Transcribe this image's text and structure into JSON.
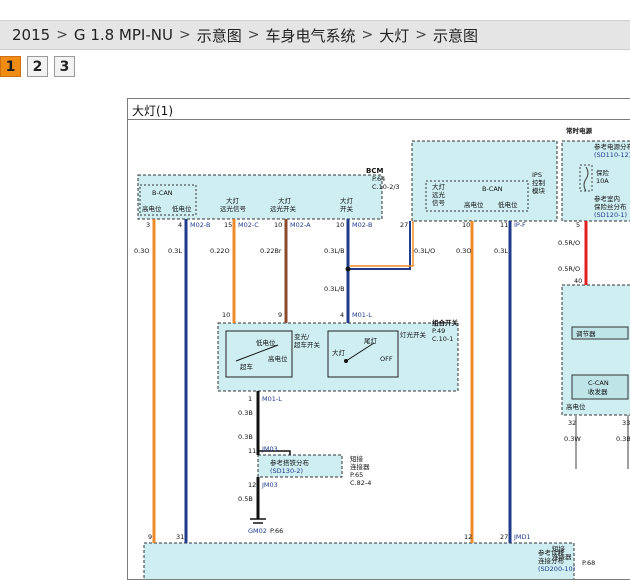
{
  "breadcrumb": [
    "2015",
    "G 1.8 MPI-NU",
    "示意图",
    "车身电气系统",
    "大灯",
    "示意图"
  ],
  "breadcrumb_separator": ">",
  "pagination": {
    "pages": [
      "1",
      "2",
      "3"
    ],
    "active_index": 0
  },
  "diagram": {
    "title": "大灯(1)",
    "colors": {
      "module_fill": "#cfeef2",
      "orange_wire": "#ef8a2a",
      "blue_wire": "#1f3b8c",
      "brown_wire": "#8b4a2b",
      "red_wire": "#e02020",
      "gray_wire": "#a0a0a0"
    },
    "bcm": {
      "name": "BCM",
      "ref_page": "P.64",
      "ref_code": "C.10-2/3",
      "bcan_label": "B-CAN",
      "high": "高电位",
      "low": "低电位",
      "pin_labels": [
        {
          "l1": "大灯",
          "l2": "远光信号"
        },
        {
          "l1": "大灯",
          "l2": "远光开关"
        },
        {
          "l1": "大灯",
          "l2": "开关"
        }
      ],
      "pins": [
        "3",
        "4",
        "15",
        "10",
        "10"
      ],
      "connectors": [
        "M02-B",
        "M02-C",
        "M02-A",
        "M02-B"
      ],
      "wires": [
        "0.3O",
        "0.3L",
        "0.22O",
        "0.22Br",
        "0.3L/B",
        "0.3L/O"
      ]
    },
    "ips": {
      "name_lines": [
        "IPS",
        "控制",
        "模块"
      ],
      "bcan_label": "B-CAN",
      "high": "高电位",
      "low": "低电位",
      "beam_lines": [
        "大灯",
        "远光",
        "信号"
      ],
      "pins": [
        "27",
        "10",
        "11"
      ],
      "connector": "IP-F",
      "wires": [
        "0.3O",
        "0.3L"
      ]
    },
    "always_power": {
      "label": "常时电源",
      "ref1": "参考电源分布",
      "ref1_code": "(SD110-12)",
      "fuse_lines": [
        "保险",
        "10A"
      ],
      "ref2_lines": [
        "参考室内",
        "保险丝分布"
      ],
      "ref2_code": "(SD120-1)",
      "pins": [
        "5",
        "40",
        "32",
        "33"
      ],
      "wires": [
        "0.5R/O",
        "0.5R/O",
        "0.3W",
        "0.3B"
      ],
      "regulator": "调节器",
      "ccan_lines": [
        "C-CAN",
        "收发器"
      ],
      "high": "高电位"
    },
    "combo_switch": {
      "name": "组合开关",
      "ref_page": "P.49",
      "ref_code": "C.10-1",
      "pins": [
        "10",
        "9",
        "4",
        "1"
      ],
      "connector_top": "M01-L",
      "connector_bottom": "M01-L",
      "left_lines": [
        "变光/",
        "超车开关"
      ],
      "low_beam": "低电位",
      "passing": "超车",
      "high_beam": "高电位",
      "light_switch": "灯光开关",
      "tail": "尾灯",
      "head": "大灯",
      "off": "OFF"
    },
    "wire_labels": [
      "0.3L/B",
      "0.3B",
      "0.3B",
      "0.5B"
    ],
    "joint": {
      "name_lines": [
        "短接",
        "连接器"
      ],
      "ref_page": "P.65",
      "ref_code": "C.82-4",
      "ref": "参考搭铁分布",
      "ref_code2": "(SD130-2)",
      "connector": "JM03",
      "pins": [
        "11",
        "12"
      ]
    },
    "ground": {
      "name": "GM02",
      "page": "P.66"
    },
    "bottom": {
      "pins": [
        "9",
        "31",
        "12",
        "27"
      ],
      "connector": "JMD1",
      "name_lines": [
        "短接",
        "连接器"
      ],
      "ref_lines": [
        "参考诊断",
        "连接分布"
      ],
      "ref_code": "(SD200-10)",
      "ref_page": "P.68"
    }
  }
}
